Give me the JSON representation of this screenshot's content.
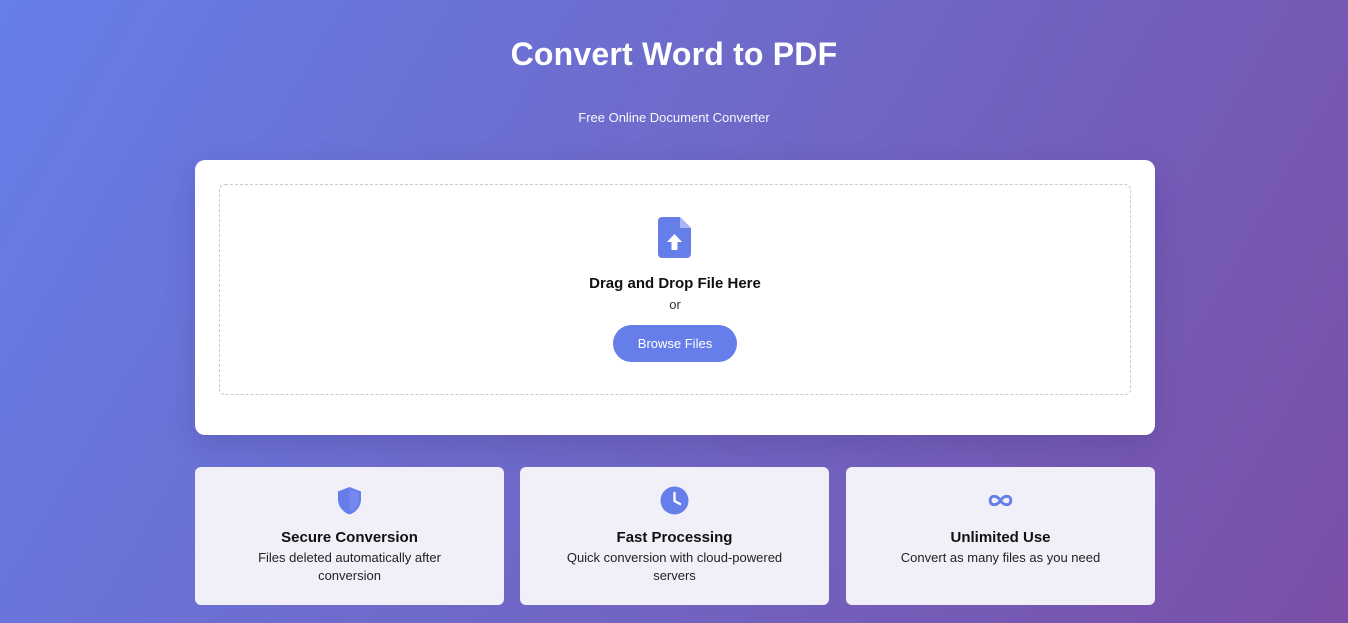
{
  "header": {
    "title": "Convert Word to PDF",
    "subtitle": "Free Online Document Converter"
  },
  "upload": {
    "icon": "file-upload-icon",
    "drop_text": "Drag and Drop File Here",
    "or_text": "or",
    "browse_label": "Browse Files"
  },
  "features": [
    {
      "icon": "shield-icon",
      "title": "Secure Conversion",
      "description": "Files deleted automatically after conversion"
    },
    {
      "icon": "clock-icon",
      "title": "Fast Processing",
      "description": "Quick conversion with cloud-powered servers"
    },
    {
      "icon": "infinity-icon",
      "title": "Unlimited Use",
      "description": "Convert as many files as you need"
    }
  ],
  "colors": {
    "accent": "#667eea",
    "gradient_start": "#667eea",
    "gradient_end": "#7a4fa8",
    "card_bg": "#ffffff",
    "feature_bg": "#f1f0f9"
  }
}
